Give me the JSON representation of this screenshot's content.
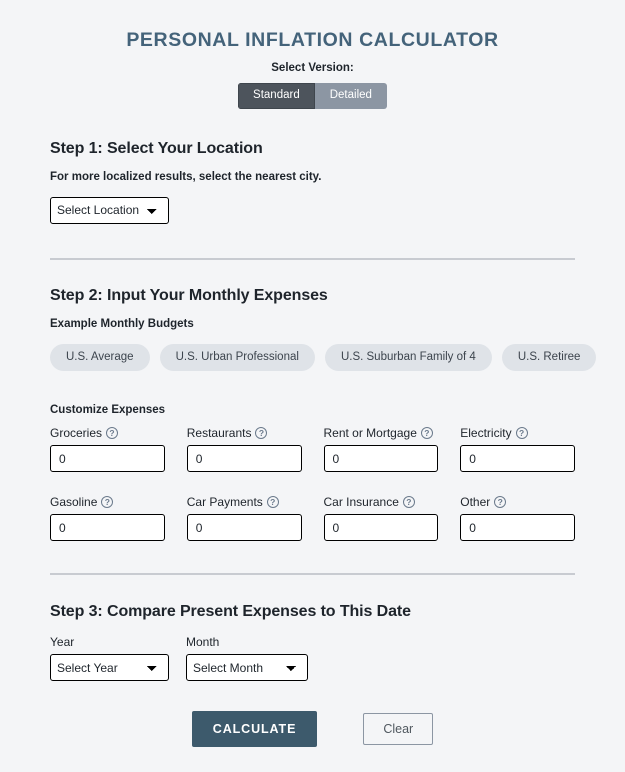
{
  "header": {
    "title": "PERSONAL INFLATION CALCULATOR",
    "version_label": "Select Version:",
    "versions": [
      {
        "label": "Standard",
        "selected": true
      },
      {
        "label": "Detailed",
        "selected": false
      }
    ]
  },
  "step1": {
    "heading": "Step 1: Select Your Location",
    "help_text": "For more localized results, select the nearest city.",
    "location_select": {
      "value": "Select Location",
      "options": [
        "Select Location"
      ]
    }
  },
  "step2": {
    "heading": "Step 2: Input Your Monthly Expenses",
    "examples_label": "Example Monthly Budgets",
    "presets": [
      {
        "label": "U.S. Average"
      },
      {
        "label": "U.S. Urban Professional"
      },
      {
        "label": "U.S. Suburban Family of 4"
      },
      {
        "label": "U.S. Retiree"
      }
    ],
    "customize_label": "Customize Expenses",
    "help_icon": "question-mark-icon",
    "help_glyph": "?",
    "fields_row1": [
      {
        "label": "Groceries",
        "value": "0"
      },
      {
        "label": "Restaurants",
        "value": "0"
      },
      {
        "label": "Rent or Mortgage",
        "value": "0"
      },
      {
        "label": "Electricity",
        "value": "0"
      }
    ],
    "fields_row2": [
      {
        "label": "Gasoline",
        "value": "0"
      },
      {
        "label": "Car Payments",
        "value": "0"
      },
      {
        "label": "Car Insurance",
        "value": "0"
      },
      {
        "label": "Other",
        "value": "0"
      }
    ]
  },
  "step3": {
    "heading": "Step 3: Compare Present Expenses to This Date",
    "year": {
      "label": "Year",
      "select_value": "Select Year",
      "options": [
        "Select Year"
      ]
    },
    "month": {
      "label": "Month",
      "select_value": "Select Month",
      "options": [
        "Select Month"
      ]
    }
  },
  "actions": {
    "calculate_label": "CALCULATE",
    "clear_label": "Clear"
  },
  "colors": {
    "page_background": "#f4f5f7",
    "title": "#44637a",
    "accent_button": "#3d5a6c",
    "toggle_active": "#4d545c",
    "toggle_inactive": "#8c96a3",
    "pill_background": "#dfe3e8",
    "divider": "#c8cbd1",
    "text": "#1e242b"
  }
}
